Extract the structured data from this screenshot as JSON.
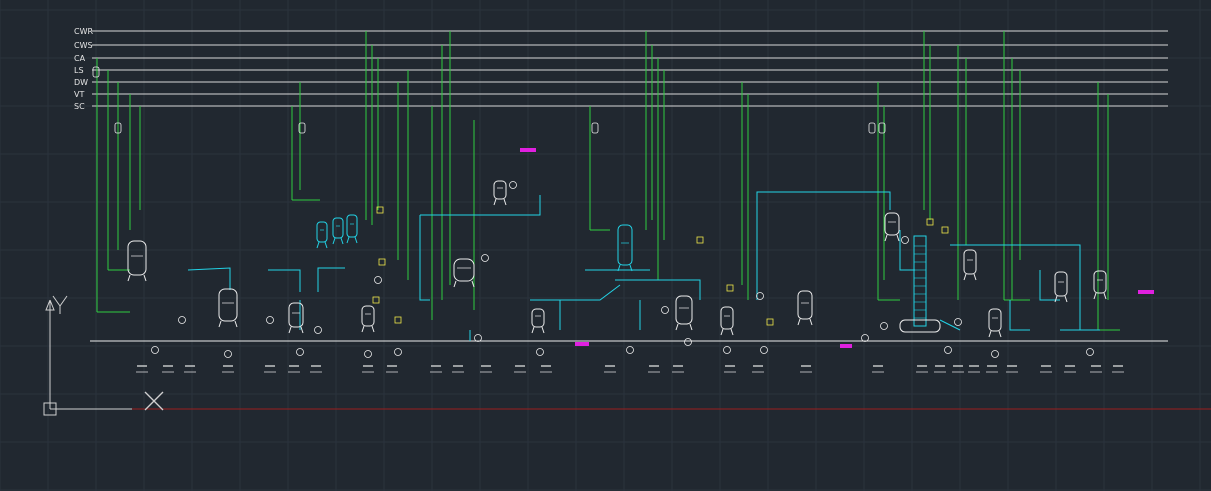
{
  "utility_lines": [
    "CWR",
    "CWS",
    "CA",
    "LS",
    "DW",
    "VT",
    "SC"
  ],
  "colors": {
    "background": "#212830",
    "grid": "#2b333d",
    "utility": "#d8d8d8",
    "process": "#22d3e6",
    "steam": "#2ecc40",
    "equipment": "#ececec",
    "valve": "#f2e94a",
    "axis_x": "#9a1e1e",
    "tag_magenta": "#e020e0"
  },
  "icons": {
    "ucs": "ucs-icon",
    "view_cross": "view-cross-icon"
  }
}
